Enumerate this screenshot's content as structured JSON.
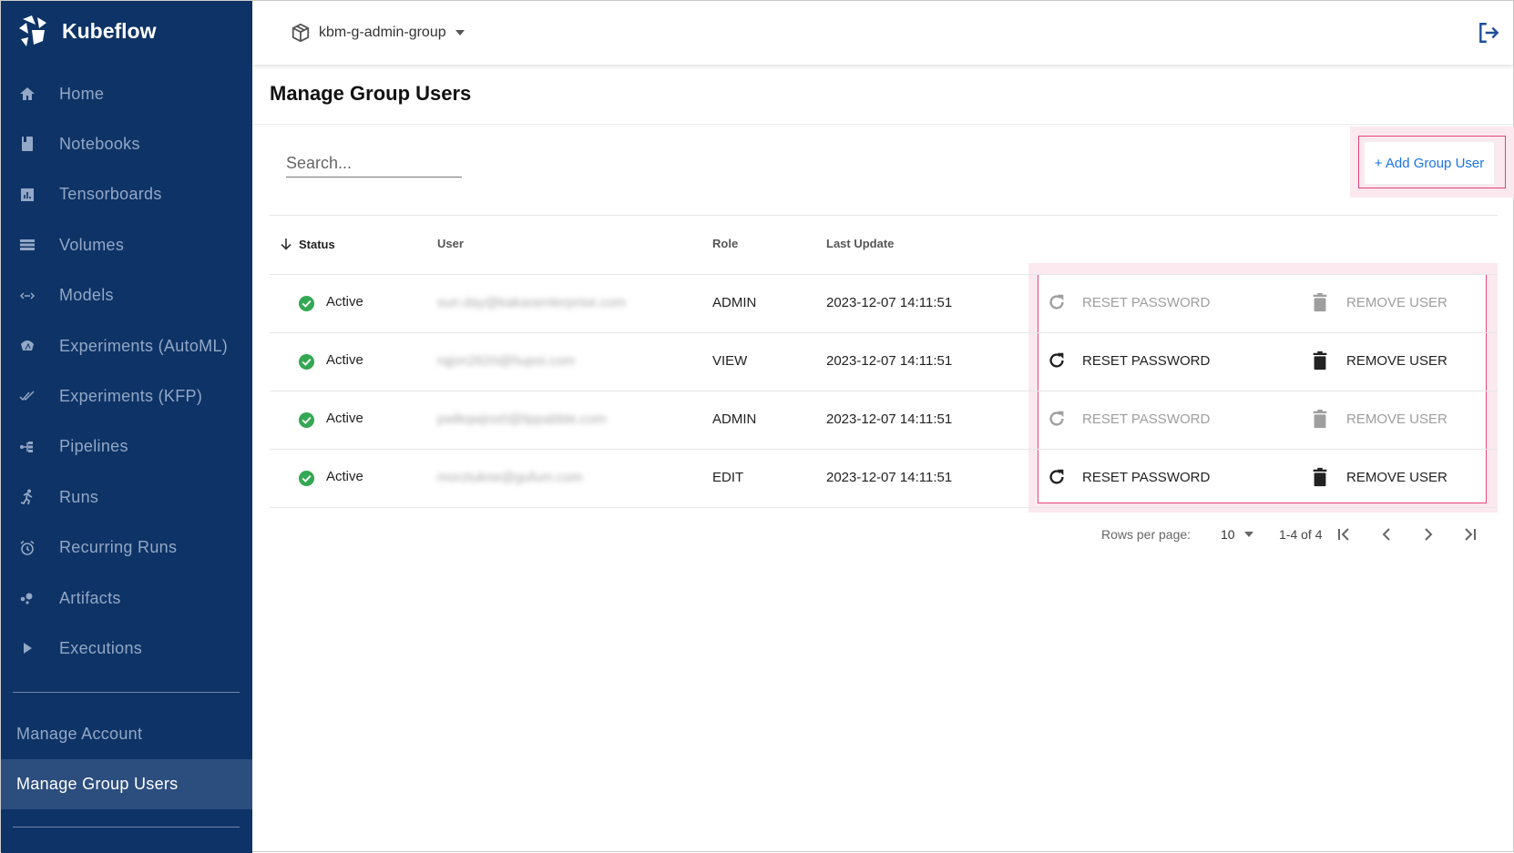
{
  "app": {
    "name": "Kubeflow"
  },
  "sidebar": {
    "items": [
      {
        "label": "Home",
        "icon": "home-icon"
      },
      {
        "label": "Notebooks",
        "icon": "notebook-icon"
      },
      {
        "label": "Tensorboards",
        "icon": "chart-icon"
      },
      {
        "label": "Volumes",
        "icon": "storage-icon"
      },
      {
        "label": "Models",
        "icon": "code-arrows-icon"
      },
      {
        "label": "Experiments (AutoML)",
        "icon": "automl-icon"
      },
      {
        "label": "Experiments (KFP)",
        "icon": "check-double-icon"
      },
      {
        "label": "Pipelines",
        "icon": "pipeline-icon"
      },
      {
        "label": "Runs",
        "icon": "run-icon"
      },
      {
        "label": "Recurring Runs",
        "icon": "alarm-icon"
      },
      {
        "label": "Artifacts",
        "icon": "bubbles-icon"
      },
      {
        "label": "Executions",
        "icon": "play-icon"
      }
    ],
    "manage_account": "Manage Account",
    "manage_group_users": "Manage Group Users"
  },
  "header": {
    "namespace": "kbm-g-admin-group"
  },
  "page": {
    "title": "Manage Group Users",
    "search_placeholder": "Search...",
    "add_button": "+ Add Group User"
  },
  "table": {
    "headers": {
      "status": "Status",
      "user": "User",
      "role": "Role",
      "last_update": "Last Update"
    },
    "sort": "descending-by-status",
    "rows": [
      {
        "status": "Active",
        "user": "sun.day@kakaoenterprise.com",
        "role": "ADMIN",
        "last_update": "2023-12-07 14:11:51",
        "actions_enabled": false
      },
      {
        "status": "Active",
        "user": "rqjon2620@hupoi.com",
        "role": "VIEW",
        "last_update": "2023-12-07 14:11:51",
        "actions_enabled": true
      },
      {
        "status": "Active",
        "user": "pwlkqwjno0@lippabble.com",
        "role": "ADMIN",
        "last_update": "2023-12-07 14:11:51",
        "actions_enabled": false
      },
      {
        "status": "Active",
        "user": "morztukne@gufum.com",
        "role": "EDIT",
        "last_update": "2023-12-07 14:11:51",
        "actions_enabled": true
      }
    ],
    "reset_label": "RESET PASSWORD",
    "remove_label": "REMOVE USER"
  },
  "pagination": {
    "rows_per_page_label": "Rows per page:",
    "rows_per_page": "10",
    "range": "1-4 of 4"
  },
  "colors": {
    "sidebar": "#0e3366",
    "accent": "#1a73e8",
    "highlight": "#e0457b",
    "active_status": "#34a853"
  }
}
